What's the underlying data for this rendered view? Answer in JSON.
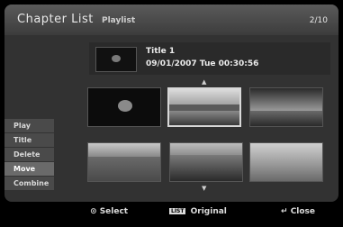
{
  "header": {
    "title": "Chapter List",
    "subtitle": "Playlist",
    "page": "2/10"
  },
  "info": {
    "title": "Title 1",
    "datetime": "09/01/2007  Tue  00:30:56"
  },
  "nav": {
    "up_icon": "triangle-up-icon",
    "down_icon": "triangle-down-icon"
  },
  "menu": {
    "items": [
      {
        "label": "Play"
      },
      {
        "label": "Title"
      },
      {
        "label": "Delete"
      },
      {
        "label": "Move"
      },
      {
        "label": "Combine"
      }
    ],
    "active_index": 3
  },
  "thumbnails": {
    "count": 6,
    "selected_index": 1,
    "scenes": [
      "dark-ball",
      "lake-landscape",
      "mountain-sky",
      "hill-landscape",
      "village-landscape",
      "hazy-sky"
    ]
  },
  "footer": {
    "select_label": "Select",
    "list_badge": "LIST",
    "original_label": "Original",
    "close_label": "Close"
  },
  "colors": {
    "panel_bg": "#323232",
    "header_bg": "#4a4a4a",
    "menu_active": "#6a6a6a",
    "text": "#e8e8e8"
  }
}
